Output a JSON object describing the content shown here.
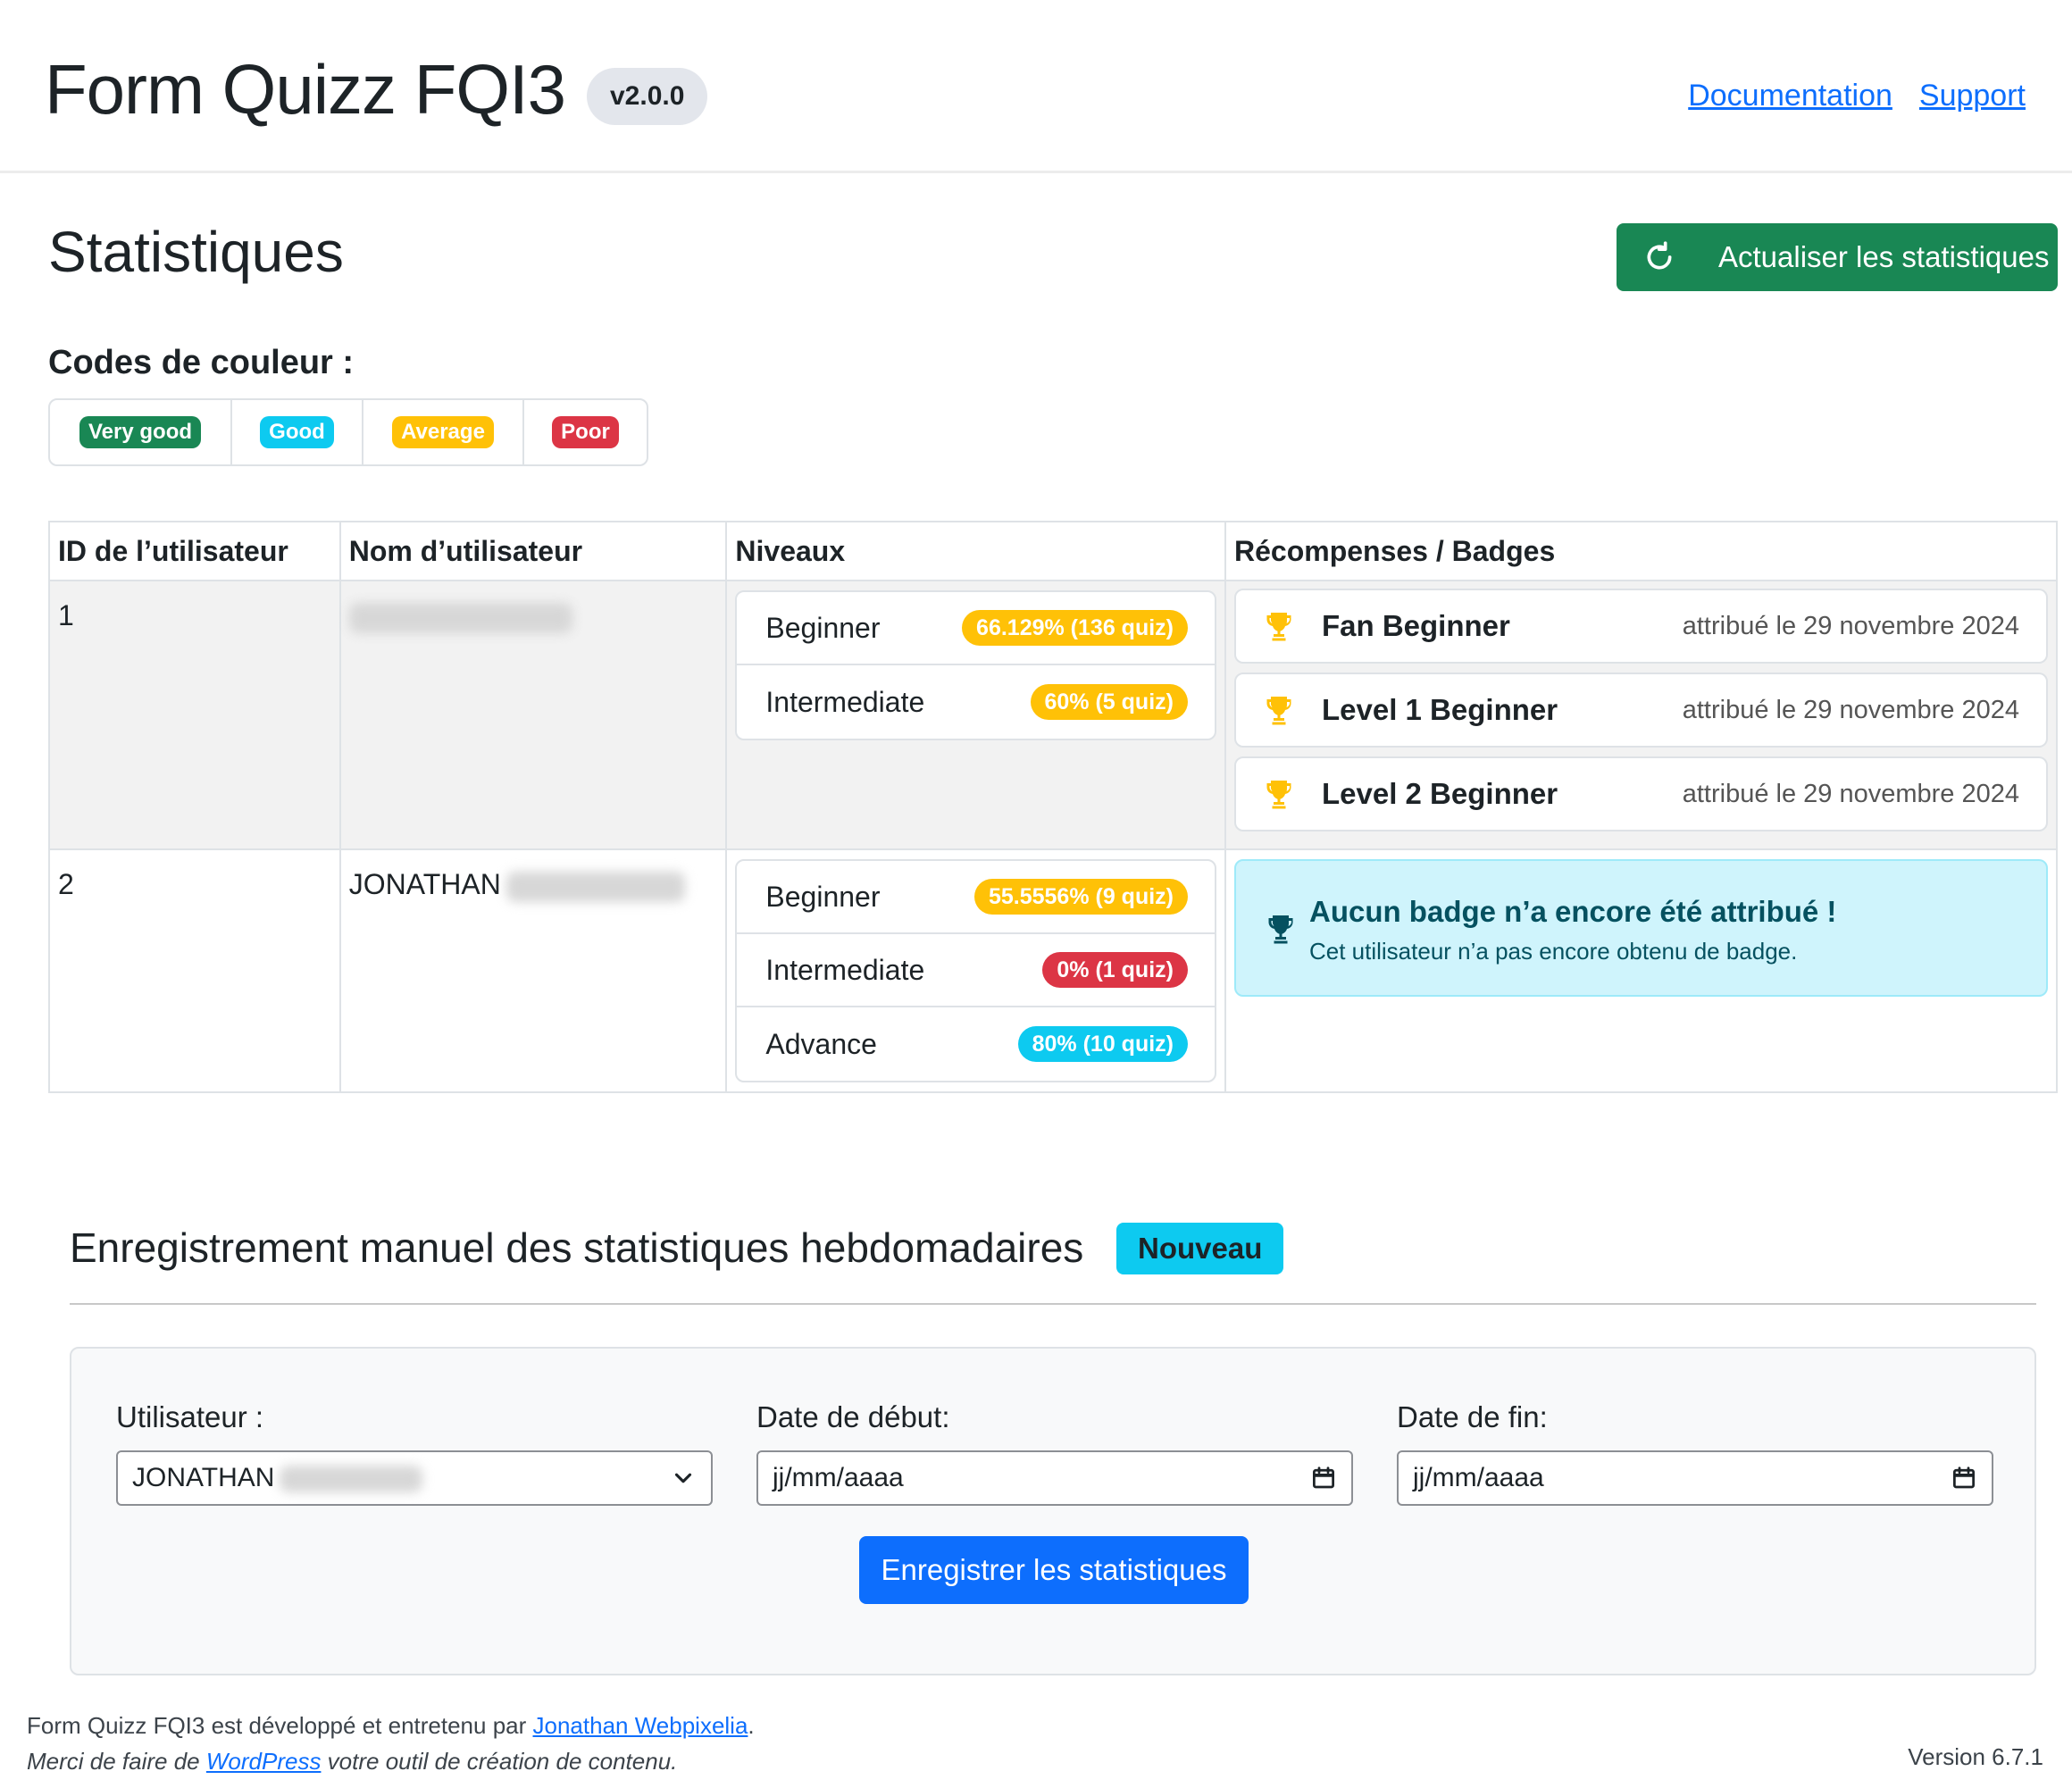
{
  "header": {
    "title": "Form Quizz FQI3",
    "version": "v2.0.0",
    "links": {
      "documentation": "Documentation",
      "support": "Support"
    }
  },
  "stats": {
    "title": "Statistiques",
    "refresh_label": "Actualiser les statistiques",
    "legend_title": "Codes de couleur :",
    "legend": [
      {
        "label": "Very good",
        "color": "#198754"
      },
      {
        "label": "Good",
        "color": "#0dcaf0"
      },
      {
        "label": "Average",
        "color": "#ffc107"
      },
      {
        "label": "Poor",
        "color": "#dc3545"
      }
    ]
  },
  "table": {
    "headers": [
      "ID de l’utilisateur",
      "Nom d’utilisateur",
      "Niveaux",
      "Récompenses / Badges"
    ],
    "rows": [
      {
        "id": "1",
        "name": "",
        "levels": [
          {
            "name": "Beginner",
            "score": "66.129% (136 quiz)",
            "color": "#ffc107"
          },
          {
            "name": "Intermediate",
            "score": "60% (5 quiz)",
            "color": "#ffc107"
          }
        ],
        "badges": [
          {
            "name": "Fan Beginner",
            "date": "attribué le 29 novembre 2024"
          },
          {
            "name": "Level 1 Beginner",
            "date": "attribué le 29 novembre 2024"
          },
          {
            "name": "Level 2 Beginner",
            "date": "attribué le 29 novembre 2024"
          }
        ]
      },
      {
        "id": "2",
        "name": "JONATHAN",
        "levels": [
          {
            "name": "Beginner",
            "score": "55.5556% (9 quiz)",
            "color": "#ffc107"
          },
          {
            "name": "Intermediate",
            "score": "0% (1 quiz)",
            "color": "#dc3545"
          },
          {
            "name": "Advance",
            "score": "80% (10 quiz)",
            "color": "#0dcaf0"
          }
        ],
        "no_badge_title": "Aucun badge n’a encore été attribué !",
        "no_badge_text": "Cet utilisateur n’a pas encore obtenu de badge."
      }
    ]
  },
  "weekly": {
    "title": "Enregistrement manuel des statistiques hebdomadaires",
    "new_badge": "Nouveau",
    "user_label": "Utilisateur :",
    "user_value": "JONATHAN",
    "start_label": "Date de début:",
    "start_placeholder": "jj/mm/aaaa",
    "end_label": "Date de fin:",
    "end_placeholder": "jj/mm/aaaa",
    "save_label": "Enregistrer les statistiques"
  },
  "footer": {
    "line1_prefix": "Form Quizz FQI3 est développé et entretenu par ",
    "line1_link": "Jonathan Webpixelia",
    "line1_suffix": ".",
    "line2_prefix": "Merci de faire de ",
    "line2_link": "WordPress",
    "line2_suffix": " votre outil de création de contenu.",
    "version": "Version 6.7.1"
  }
}
